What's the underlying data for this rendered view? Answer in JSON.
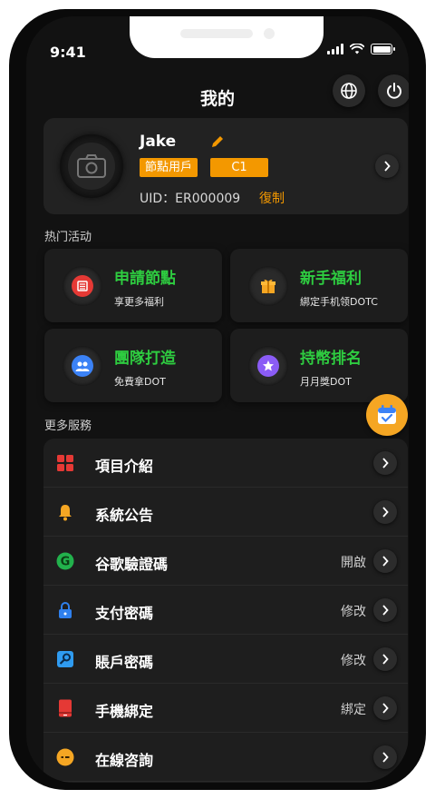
{
  "status_bar": {
    "time": "9:41"
  },
  "header": {
    "title": "我的"
  },
  "profile": {
    "username": "Jake",
    "role_tag": "節點用戶",
    "level_tag": "C1",
    "uid": "UID：ER000009",
    "copy_label": "復制"
  },
  "activities": {
    "section_title": "热门活动",
    "items": [
      {
        "title": "申請節點",
        "subtitle": "享更多福利",
        "icon": "node-icon",
        "color": "#e53935"
      },
      {
        "title": "新手福利",
        "subtitle": "綁定手机领DOTC",
        "icon": "gift-icon",
        "color": "#f5a623"
      },
      {
        "title": "團隊打造",
        "subtitle": "免費拿DOT",
        "icon": "team-icon",
        "color": "#3b82f6"
      },
      {
        "title": "持幣排名",
        "subtitle": "月月獎DOT",
        "icon": "rank-icon",
        "color": "#8b5cf6"
      }
    ]
  },
  "services": {
    "section_title": "更多服務",
    "items": [
      {
        "label": "項目介紹",
        "value": "",
        "icon": "grid-icon"
      },
      {
        "label": "系統公告",
        "value": "",
        "icon": "bell-icon"
      },
      {
        "label": "谷歌驗證碼",
        "value": "開啟",
        "icon": "google-icon"
      },
      {
        "label": "支付密碼",
        "value": "修改",
        "icon": "lock-icon"
      },
      {
        "label": "賬戶密碼",
        "value": "修改",
        "icon": "key-icon"
      },
      {
        "label": "手機綁定",
        "value": "綁定",
        "icon": "phone-icon"
      },
      {
        "label": "在線咨詢",
        "value": "",
        "icon": "chat-icon"
      }
    ]
  },
  "colors": {
    "accent": "#f39800",
    "green": "#2ecc40",
    "background": "#121212",
    "card": "#222222"
  }
}
